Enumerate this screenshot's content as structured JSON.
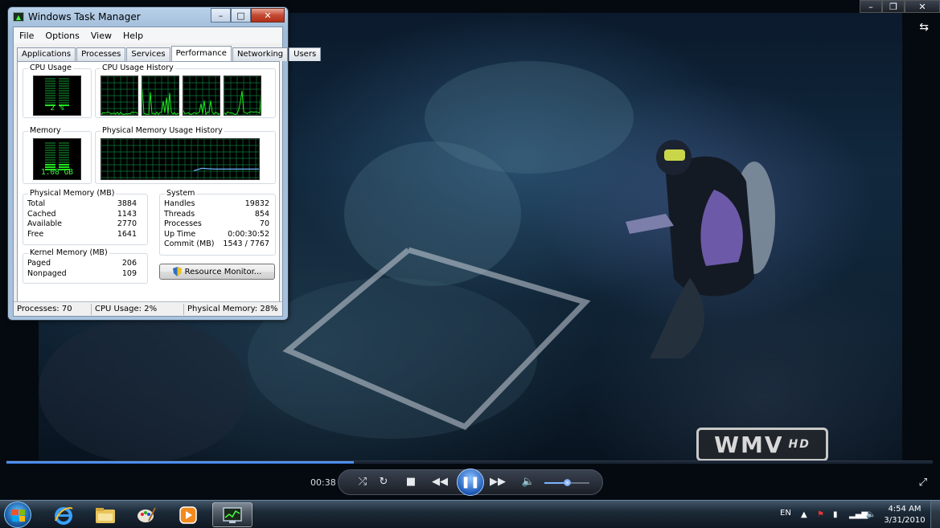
{
  "player": {
    "time_elapsed": "00:38",
    "progress_fraction": 0.375,
    "volume_fraction": 0.5,
    "watermark_text": "WMV",
    "watermark_badge": "HD",
    "window_buttons": {
      "minimize": "–",
      "maximize": "❐",
      "close": "✕"
    },
    "icons": [
      "switch-to-library-icon",
      "shuffle-icon",
      "repeat-icon",
      "stop-icon",
      "previous-icon",
      "pause-icon",
      "next-icon",
      "volume-icon",
      "fullscreen-icon"
    ],
    "accent_color": "#2d6fd6"
  },
  "task_manager": {
    "title": "Windows Task Manager",
    "caption": {
      "minimize": "–",
      "maximize": "□",
      "close": "✕"
    },
    "menu": [
      "File",
      "Options",
      "View",
      "Help"
    ],
    "tabs": [
      "Applications",
      "Processes",
      "Services",
      "Performance",
      "Networking",
      "Users"
    ],
    "active_tab": "Performance",
    "cpu_usage": {
      "label": "CPU Usage",
      "value": "2 %",
      "fraction": 0.02
    },
    "cpu_history": {
      "label": "CPU Usage History",
      "cores": 4
    },
    "memory": {
      "label": "Memory",
      "value": "1.08 GB",
      "fraction": 0.28
    },
    "memory_history": {
      "label": "Physical Memory Usage History"
    },
    "physical_memory": {
      "label": "Physical Memory (MB)",
      "rows": [
        {
          "name": "Total",
          "value": "3884"
        },
        {
          "name": "Cached",
          "value": "1143"
        },
        {
          "name": "Available",
          "value": "2770"
        },
        {
          "name": "Free",
          "value": "1641"
        }
      ]
    },
    "kernel_memory": {
      "label": "Kernel Memory (MB)",
      "rows": [
        {
          "name": "Paged",
          "value": "206"
        },
        {
          "name": "Nonpaged",
          "value": "109"
        }
      ]
    },
    "system": {
      "label": "System",
      "rows": [
        {
          "name": "Handles",
          "value": "19832"
        },
        {
          "name": "Threads",
          "value": "854"
        },
        {
          "name": "Processes",
          "value": "70"
        },
        {
          "name": "Up Time",
          "value": "0:00:30:52"
        },
        {
          "name": "Commit (MB)",
          "value": "1543 / 7767"
        }
      ]
    },
    "resource_monitor_button": "Resource Monitor...",
    "status": {
      "processes": "Processes: 70",
      "cpu": "CPU Usage: 2%",
      "memory": "Physical Memory: 28%"
    },
    "graph_color": "#1ee61e",
    "grid_color": "#0a7a3a"
  },
  "taskbar": {
    "pinned": [
      "internet-explorer-icon",
      "windows-explorer-icon",
      "paint-icon",
      "windows-media-player-icon",
      "task-manager-icon"
    ],
    "language": "EN",
    "time": "4:54 AM",
    "date": "3/31/2010"
  }
}
